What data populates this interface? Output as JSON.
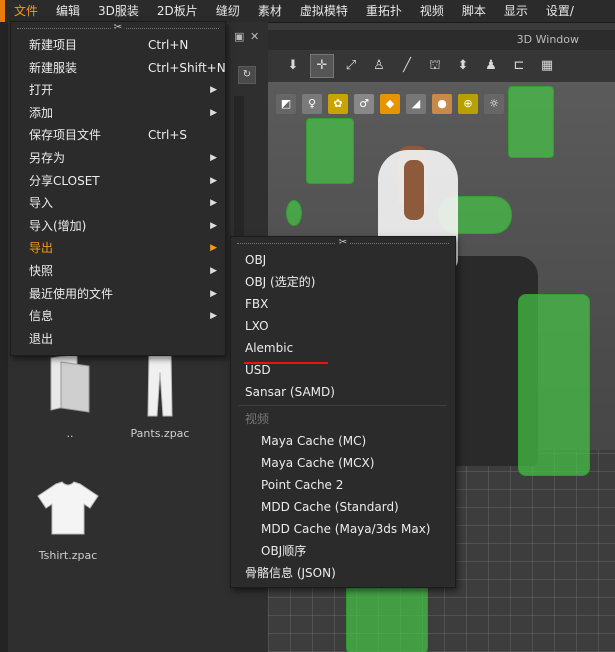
{
  "menubar": {
    "items": [
      "文件",
      "编辑",
      "3D服装",
      "2D板片",
      "缝纫",
      "素材",
      "虚拟模特",
      "重拓扑",
      "视频",
      "脚本",
      "显示",
      "设置/"
    ],
    "active_index": 0
  },
  "accent_color": "#f39c12",
  "library": {
    "files": [
      {
        "label": "..",
        "icon": "folder-icon"
      },
      {
        "label": "Pants.zpac",
        "icon": "pants-icon"
      },
      {
        "label": "Tshirt.zpac",
        "icon": "tshirt-icon"
      }
    ]
  },
  "view3d": {
    "title": "3D Window"
  },
  "file_menu": {
    "grip": "✂",
    "items": [
      {
        "label": "新建项目",
        "shortcut": "Ctrl+N",
        "submenu": false
      },
      {
        "label": "新建服装",
        "shortcut": "Ctrl+Shift+N",
        "submenu": false
      },
      {
        "label": "打开",
        "shortcut": "",
        "submenu": true
      },
      {
        "label": "添加",
        "shortcut": "",
        "submenu": true
      },
      {
        "label": "保存项目文件",
        "shortcut": "Ctrl+S",
        "submenu": false
      },
      {
        "label": "另存为",
        "shortcut": "",
        "submenu": true
      },
      {
        "label": "分享CLOSET",
        "shortcut": "",
        "submenu": true
      },
      {
        "label": "导入",
        "shortcut": "",
        "submenu": true
      },
      {
        "label": "导入(增加)",
        "shortcut": "",
        "submenu": true
      },
      {
        "label": "导出",
        "shortcut": "",
        "submenu": true,
        "active": true
      },
      {
        "label": "快照",
        "shortcut": "",
        "submenu": true
      },
      {
        "label": "最近使用的文件",
        "shortcut": "",
        "submenu": true
      },
      {
        "label": "信息",
        "shortcut": "",
        "submenu": true
      },
      {
        "label": "退出",
        "shortcut": "",
        "submenu": false
      }
    ]
  },
  "export_menu": {
    "grip": "✂",
    "items": [
      {
        "label": "OBJ"
      },
      {
        "label": "OBJ (选定的)"
      },
      {
        "label": "FBX"
      },
      {
        "label": "LXO"
      },
      {
        "label": "Alembic",
        "underlined": true
      },
      {
        "label": "USD"
      },
      {
        "label": "Sansar (SAMD)"
      },
      {
        "label": "视频",
        "disabled": true
      },
      {
        "label": "Maya Cache (MC)",
        "indent": true
      },
      {
        "label": "Maya Cache (MCX)",
        "indent": true
      },
      {
        "label": "Point Cache 2",
        "indent": true
      },
      {
        "label": "MDD Cache (Standard)",
        "indent": true
      },
      {
        "label": "MDD Cache (Maya/3ds Max)",
        "indent": true
      },
      {
        "label": "OBJ顺序",
        "indent": true
      },
      {
        "label": "骨骼信息 (JSON)"
      }
    ]
  }
}
